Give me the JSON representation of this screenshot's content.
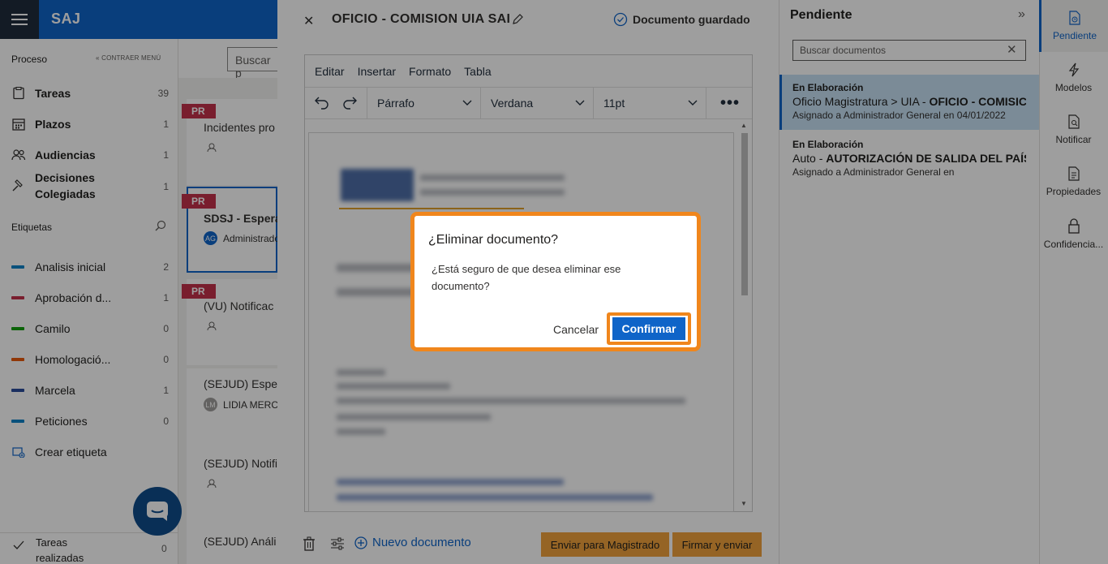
{
  "app": {
    "title": "SAJ",
    "search_placeholder": "Buscar p"
  },
  "sidebar": {
    "process_header": "Proceso",
    "collapse_label": "CONTRAER MENÚ",
    "nav": [
      {
        "label": "Tareas",
        "count": "39",
        "icon": "clipboard-icon"
      },
      {
        "label": "Plazos",
        "count": "1",
        "icon": "calendar-icon"
      },
      {
        "label": "Audiencias",
        "count": "1",
        "icon": "people-icon"
      },
      {
        "label": "Decisiones\nColegiadas",
        "count": "1",
        "icon": "gavel-icon"
      }
    ],
    "tags_header": "Etiquetas",
    "tags": [
      {
        "label": "Analisis inicial",
        "count": "2",
        "color": "#0f84c8"
      },
      {
        "label": "Aprobación d...",
        "count": "1",
        "color": "#c4314b"
      },
      {
        "label": "Camilo",
        "count": "0",
        "color": "#13a10e"
      },
      {
        "label": "Homologació...",
        "count": "0",
        "color": "#e8590c"
      },
      {
        "label": "Marcela",
        "count": "1",
        "color": "#2b4c9b"
      },
      {
        "label": "Peticiones",
        "count": "0",
        "color": "#0f84c8"
      }
    ],
    "create_tag": "Crear etiqueta",
    "tasks_done_label": "Tareas\nrealizadas",
    "tasks_done_count": "0"
  },
  "list": {
    "cards": [
      {
        "badge": "PR",
        "title": "Incidentes pro"
      },
      {
        "badge": "PR",
        "title": "SDSJ - Esperar",
        "avatar": "AG",
        "sub": "Administrado"
      },
      {
        "badge": "PR",
        "title": "(VU) Notificac"
      },
      {
        "title": "(SEJUD) Esper",
        "avatar": "LM",
        "sub": "LIDIA MERCE"
      },
      {
        "title": "(SEJUD) Notifi"
      },
      {
        "title": "(SEJUD) Análi"
      }
    ]
  },
  "editor": {
    "title": "OFICIO - COMISION UIA SAI",
    "saved_status": "Documento guardado",
    "menu": [
      "Editar",
      "Insertar",
      "Formato",
      "Tabla"
    ],
    "block_format": "Párrafo",
    "font_family": "Verdana",
    "font_size": "11pt",
    "new_document": "Nuevo documento",
    "send_magistrate": "Enviar para Magistrado",
    "sign_send": "Firmar y enviar"
  },
  "pending_panel": {
    "title": "Pendiente",
    "search_placeholder": "Buscar documentos",
    "items": [
      {
        "state": "En Elaboración",
        "name_prefix": "Oficio Magistratura > UIA - ",
        "name_bold": "OFICIO - COMISIC",
        "assigned": "Asignado a Administrador General en 04/01/2022"
      },
      {
        "state": "En Elaboración",
        "name_prefix": "Auto - ",
        "name_bold": "AUTORIZACIÓN DE SALIDA DEL PAÍS S",
        "assigned": "Asignado a Administrador General en"
      }
    ]
  },
  "rail": [
    {
      "label": "Pendiente",
      "icon": "pending-doc-icon"
    },
    {
      "label": "Modelos",
      "icon": "lightning-icon"
    },
    {
      "label": "Notificar",
      "icon": "notify-doc-icon"
    },
    {
      "label": "Propiedades",
      "icon": "properties-doc-icon"
    },
    {
      "label": "Confidencia...",
      "icon": "lock-icon"
    }
  ],
  "dialog": {
    "title": "¿Eliminar documento?",
    "body": "¿Está seguro de que desea eliminar ese documento?",
    "cancel": "Cancelar",
    "confirm": "Confirmar"
  }
}
